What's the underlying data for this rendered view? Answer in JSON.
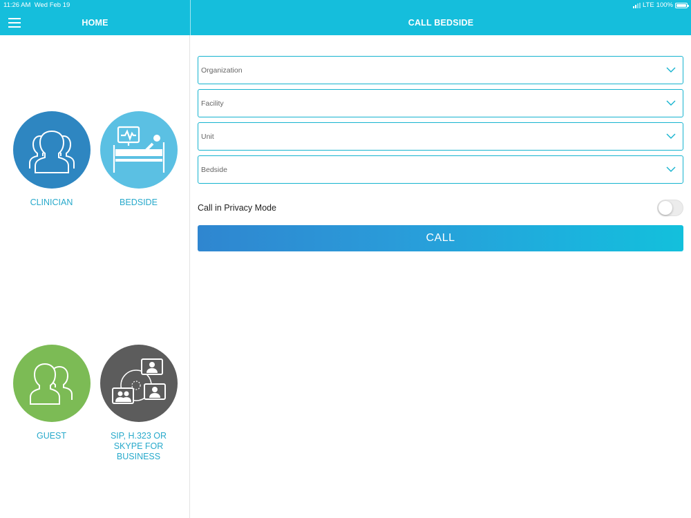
{
  "status_bar": {
    "time": "11:26 AM",
    "date": "Wed Feb 19",
    "network": "LTE",
    "battery": "100%"
  },
  "header": {
    "home_title": "HOME",
    "page_title": "CALL BEDSIDE"
  },
  "sidebar": {
    "tiles": [
      {
        "label": "CLINICIAN",
        "color": "#2e86c1",
        "icon": "clinician-group-icon"
      },
      {
        "label": "BEDSIDE",
        "color": "#5bc0e3",
        "icon": "hospital-bed-icon"
      },
      {
        "label": "GUEST",
        "color": "#7cbb55",
        "icon": "guest-users-icon"
      },
      {
        "label": "SIP, H.323 OR SKYPE FOR BUSINESS",
        "color": "#5c5c5c",
        "icon": "video-conference-icon"
      }
    ]
  },
  "form": {
    "organization_placeholder": "Organization",
    "facility_placeholder": "Facility",
    "unit_placeholder": "Unit",
    "bedside_placeholder": "Bedside",
    "privacy_label": "Call in Privacy Mode",
    "privacy_enabled": false,
    "call_label": "CALL"
  },
  "colors": {
    "accent": "#15bedc",
    "field_border": "#14b3cf",
    "label_text": "#27a9cb"
  }
}
